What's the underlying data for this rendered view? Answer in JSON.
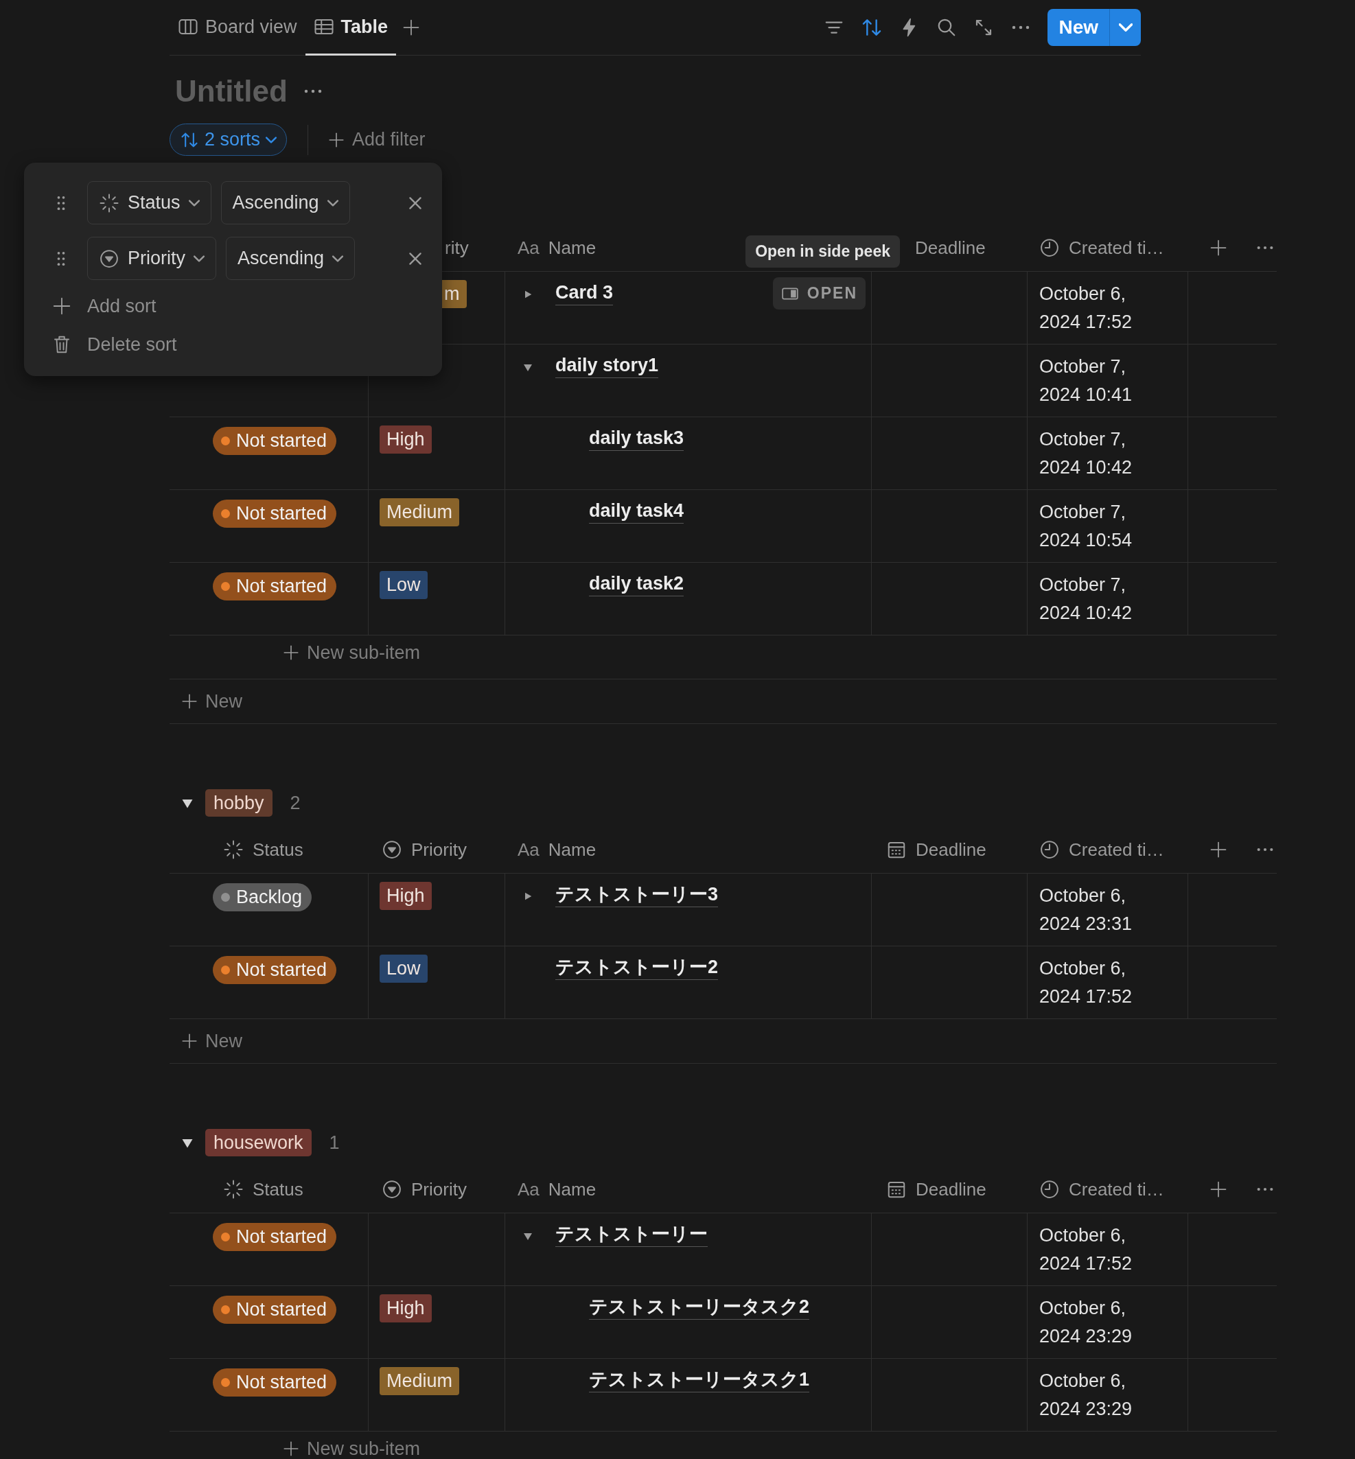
{
  "view_tabs": [
    {
      "label": "Board view",
      "kind": "board",
      "selected": false
    },
    {
      "label": "Table",
      "kind": "table",
      "selected": true
    }
  ],
  "toolbar": {
    "sort_active": true,
    "new_button": "New"
  },
  "title": "Untitled",
  "sorts_chip": "2 sorts",
  "add_filter": "Add filter",
  "sort_menu": {
    "rules": [
      {
        "property": "Status",
        "kind": "status",
        "direction": "Ascending"
      },
      {
        "property": "Priority",
        "kind": "priority",
        "direction": "Ascending"
      }
    ],
    "add_sort": "Add sort",
    "delete_sort": "Delete sort"
  },
  "groups": [
    {
      "columns": [
        {
          "kind": "priority",
          "label": "rity",
          "clipped": true
        },
        {
          "kind": "name",
          "icon_text": "Aa",
          "label": "Name"
        },
        {
          "kind": "deadline",
          "label": "Deadline",
          "clipped": true
        },
        {
          "kind": "created",
          "label": "Created ti…"
        }
      ],
      "rows": [
        {
          "priority": {
            "label": "m",
            "color": "#89632a",
            "clipped": true
          },
          "name": "Card 3",
          "expanded": false,
          "open_button": "OPEN",
          "tooltip": "Open in side peek",
          "created": "October 6, 2024 17:52"
        },
        {
          "name": "daily story1",
          "expanded": true,
          "created": "October 7, 2024 10:41",
          "new_sub_item": "New sub-item",
          "children": [
            {
              "status": {
                "label": "Not started",
                "color": "#93501c"
              },
              "priority": {
                "label": "High",
                "color": "#6e3630"
              },
              "name": "daily task3",
              "created": "October 7, 2024 10:42"
            },
            {
              "status": {
                "label": "Not started",
                "color": "#93501c"
              },
              "priority": {
                "label": "Medium",
                "color": "#89632a"
              },
              "name": "daily task4",
              "created": "October 7, 2024 10:54"
            },
            {
              "status": {
                "label": "Not started",
                "color": "#93501c"
              },
              "priority": {
                "label": "Low",
                "color": "#28456c"
              },
              "name": "daily task2",
              "created": "October 7, 2024 10:42"
            }
          ]
        }
      ],
      "new_label": "New"
    },
    {
      "tag": {
        "label": "hobby",
        "color": "#603b2c"
      },
      "count": "2",
      "expanded": true,
      "columns": [
        {
          "kind": "status",
          "label": "Status"
        },
        {
          "kind": "priority",
          "label": "Priority"
        },
        {
          "kind": "name",
          "icon_text": "Aa",
          "label": "Name"
        },
        {
          "kind": "deadline",
          "label": "Deadline"
        },
        {
          "kind": "created",
          "label": "Created ti…"
        }
      ],
      "rows": [
        {
          "status": {
            "label": "Backlog",
            "color": "#5a5a5a"
          },
          "priority": {
            "label": "High",
            "color": "#6e3630"
          },
          "name": "テストストーリー3",
          "expanded": false,
          "created": "October 6, 2024 23:31"
        },
        {
          "status": {
            "label": "Not started",
            "color": "#93501c"
          },
          "priority": {
            "label": "Low",
            "color": "#28456c"
          },
          "name": "テストストーリー2",
          "created": "October 6, 2024 17:52"
        }
      ],
      "new_label": "New"
    },
    {
      "tag": {
        "label": "housework",
        "color": "#6e3630"
      },
      "count": "1",
      "expanded": true,
      "columns": [
        {
          "kind": "status",
          "label": "Status"
        },
        {
          "kind": "priority",
          "label": "Priority"
        },
        {
          "kind": "name",
          "icon_text": "Aa",
          "label": "Name"
        },
        {
          "kind": "deadline",
          "label": "Deadline"
        },
        {
          "kind": "created",
          "label": "Created ti…"
        }
      ],
      "rows": [
        {
          "status": {
            "label": "Not started",
            "color": "#93501c"
          },
          "name": "テストストーリー",
          "expanded": true,
          "created": "October 6, 2024 17:52",
          "new_sub_item": "New sub-item",
          "children": [
            {
              "status": {
                "label": "Not started",
                "color": "#93501c"
              },
              "priority": {
                "label": "High",
                "color": "#6e3630"
              },
              "name": "テストストーリータスク2",
              "created": "October 6, 2024 23:29"
            },
            {
              "status": {
                "label": "Not started",
                "color": "#93501c"
              },
              "priority": {
                "label": "Medium",
                "color": "#89632a"
              },
              "name": "テストストーリータスク1",
              "created": "October 6, 2024 23:29"
            }
          ]
        }
      ]
    }
  ]
}
